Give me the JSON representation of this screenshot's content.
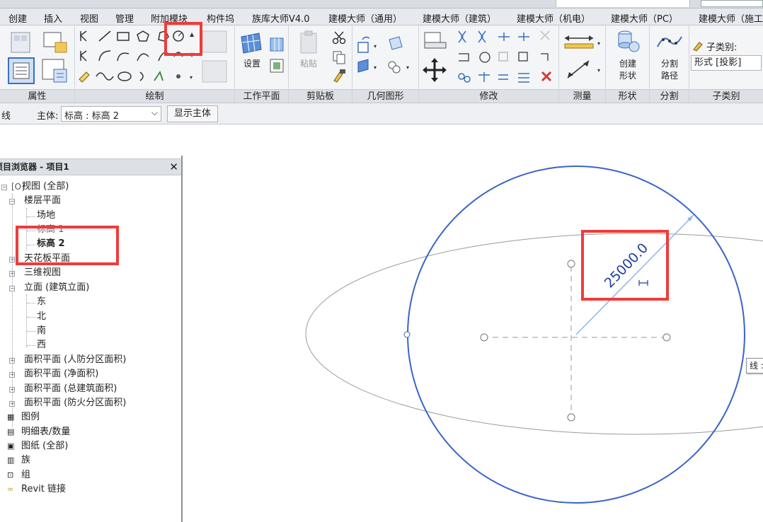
{
  "menu_tabs": [
    "创建",
    "插入",
    "视图",
    "管理",
    "附加模块",
    "构件坞",
    "族库大师V4.0",
    "建模大师（通用）",
    "建模大师（建筑）",
    "建模大师（机电）",
    "建模大师（PC）",
    "建模大师（施工"
  ],
  "ribbon": {
    "panels": {
      "properties": "属性",
      "draw": "绘制",
      "workplane": "工作平面",
      "clipboard": "剪贴板",
      "geometry": "几何图形",
      "modify": "修改",
      "measure": "测量",
      "form": "形状",
      "divide": "分割",
      "subcategory": "子类别"
    },
    "set_label": "设置",
    "paste_label": "粘贴",
    "create_form_label": [
      "创建",
      "形状"
    ],
    "divide_path_label": [
      "分割",
      "路径"
    ],
    "subcategory_label": "子类别:",
    "subcategory_value": "形式 [投影]"
  },
  "options_bar": {
    "prefix": "线",
    "host_label": "主体:",
    "host_value": "标高 : 标高 2",
    "show_host_button": "显示主体"
  },
  "browser": {
    "title": "项目浏览器 - 项目1",
    "views_all": "视图 (全部)",
    "floor_plans": "楼层平面",
    "site": "场地",
    "level1": "标高 1",
    "level2": "标高 2",
    "ceiling_plans": "天花板平面",
    "views3d": "三维视图",
    "elevations": "立面 (建筑立面)",
    "east": "东",
    "north": "北",
    "south": "南",
    "west": "西",
    "area_civil": "面积平面 (人防分区面积)",
    "area_net": "面积平面 (净面积)",
    "area_gross": "面积平面 (总建筑面积)",
    "area_fire": "面积平面 (防火分区面积)",
    "legends": "图例",
    "schedules": "明细表/数量",
    "sheets": "图纸 (全部)",
    "families": "族",
    "groups": "组",
    "revit_links": "Revit 链接"
  },
  "canvas": {
    "dimension_value": "25000.0",
    "tooltip": "线 :"
  },
  "colors": {
    "accent_blue": "#3a64c8",
    "highlight_red": "#ef3b3b",
    "dimension_text": "#1f3f9a"
  }
}
